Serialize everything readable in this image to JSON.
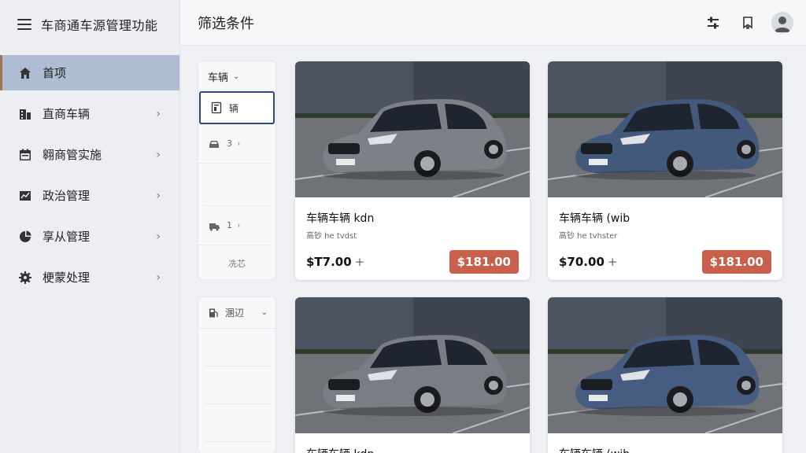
{
  "app": {
    "title": "车商通车源管理功能"
  },
  "sidebar": {
    "items": [
      {
        "label": "首项",
        "icon": "home-icon",
        "active": true
      },
      {
        "label": "直商车辆",
        "icon": "building-icon",
        "active": false
      },
      {
        "label": "翱商管实施",
        "icon": "calendar-icon",
        "active": false
      },
      {
        "label": "政治管理",
        "icon": "chart-icon",
        "active": false
      },
      {
        "label": "享从管理",
        "icon": "pie-icon",
        "active": false
      },
      {
        "label": "梗蒙处理",
        "icon": "gear-icon",
        "active": false
      }
    ]
  },
  "header": {
    "title": "筛选条件"
  },
  "filter": {
    "head": "车辆",
    "selected": "辆",
    "rows": [
      {
        "count": "3"
      },
      {
        "count": "1"
      }
    ],
    "footer": "冼芯",
    "second_head": "溷辺"
  },
  "cars": [
    {
      "name": "车辆车辆 kdn",
      "sub": "高钞 he tvdst",
      "price": "$T7.00",
      "button": "$181.00",
      "color": "#7d8087"
    },
    {
      "name": "车辆车辆 (wib",
      "sub": "高钞 he tvhster",
      "price": "$70.00",
      "button": "$181.00",
      "color": "#43597c"
    },
    {
      "name": "车辆车辆 kdn",
      "sub": "",
      "price": "",
      "button": "",
      "color": "#7a7d84"
    },
    {
      "name": "车辆车辆 (wib",
      "sub": "",
      "price": "",
      "button": "",
      "color": "#465c80"
    }
  ],
  "colors": {
    "accent": "#2d4a78",
    "button": "#c9604c",
    "active_nav": "#aebdd1"
  }
}
